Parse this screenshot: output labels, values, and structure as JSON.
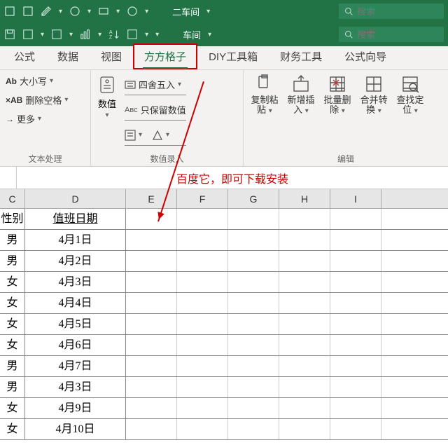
{
  "qat_rows": [
    {
      "center": "二车间",
      "search_placeholder": "搜索"
    },
    {
      "center": "车间",
      "search_placeholder": "搜索"
    }
  ],
  "tabs": [
    {
      "label": "公式",
      "active": false
    },
    {
      "label": "数据",
      "active": false
    },
    {
      "label": "视图",
      "active": false
    },
    {
      "label": "方方格子",
      "active": true
    },
    {
      "label": "DIY工具箱",
      "active": false
    },
    {
      "label": "财务工具",
      "active": false
    },
    {
      "label": "公式向导",
      "active": false
    }
  ],
  "ribbon": {
    "text_group": {
      "items": [
        {
          "prefix": "Ab",
          "label": "大小写"
        },
        {
          "prefix": "×AB",
          "label": "删除空格"
        },
        {
          "prefix": "→",
          "label": "更多"
        }
      ],
      "group_label": "文本处理"
    },
    "num_group": {
      "main": {
        "label": "数值"
      },
      "sub": [
        {
          "label": "四舍五入"
        },
        {
          "label": "只保留数值"
        }
      ],
      "group_label": "数值录入"
    },
    "edit_group": {
      "buttons": [
        {
          "l1": "复制粘",
          "l2": "贴"
        },
        {
          "l1": "新增插",
          "l2": "入"
        },
        {
          "l1": "批量删",
          "l2": "除"
        },
        {
          "l1": "合并转",
          "l2": "换"
        },
        {
          "l1": "查找定",
          "l2": "位"
        }
      ],
      "group_label": "编辑"
    }
  },
  "formula_bar_text": "百度它，即可下载安装",
  "columns": [
    "C",
    "D",
    "E",
    "F",
    "G",
    "H",
    "I"
  ],
  "header_row": {
    "c": "性别",
    "d": "值班日期"
  },
  "rows": [
    {
      "c": "男",
      "d": "4月1日"
    },
    {
      "c": "男",
      "d": "4月2日"
    },
    {
      "c": "女",
      "d": "4月3日"
    },
    {
      "c": "女",
      "d": "4月4日"
    },
    {
      "c": "女",
      "d": "4月5日"
    },
    {
      "c": "女",
      "d": "4月6日"
    },
    {
      "c": "男",
      "d": "4月7日"
    },
    {
      "c": "男",
      "d": "4月3日"
    },
    {
      "c": "女",
      "d": "4月9日"
    },
    {
      "c": "女",
      "d": "4月10日"
    }
  ]
}
